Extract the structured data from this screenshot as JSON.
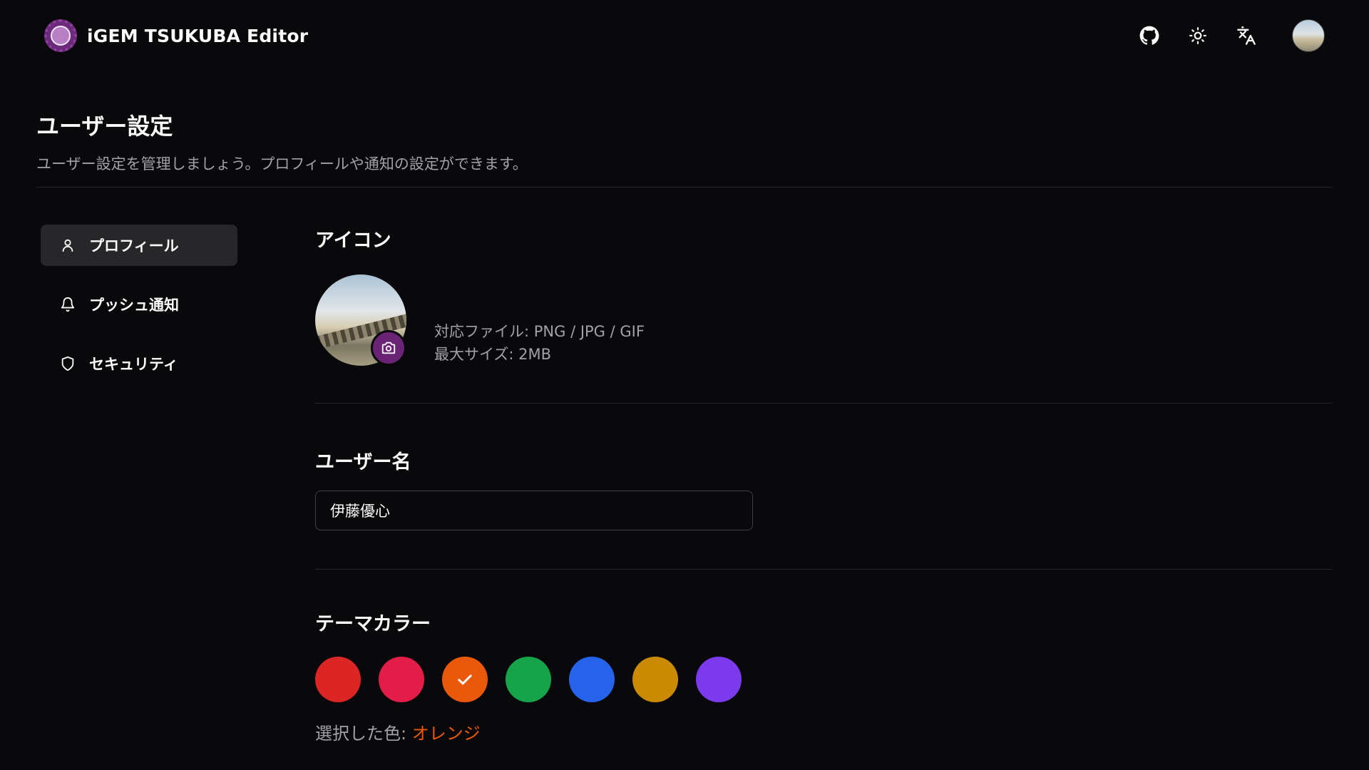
{
  "header": {
    "brand_title": "iGEM TSUKUBA Editor",
    "icons": [
      "github-icon",
      "sun-icon",
      "translate-icon"
    ]
  },
  "page": {
    "title": "ユーザー設定",
    "description": "ユーザー設定を管理しましょう。プロフィールや通知の設定ができます。"
  },
  "sidebar": {
    "items": [
      {
        "label": "プロフィール",
        "icon": "user-icon",
        "active": true
      },
      {
        "label": "プッシュ通知",
        "icon": "bell-icon",
        "active": false
      },
      {
        "label": "セキュリティ",
        "icon": "shield-icon",
        "active": false
      }
    ]
  },
  "profile": {
    "icon_section": {
      "title": "アイコン",
      "file_types": "対応ファイル: PNG / JPG / GIF",
      "max_size": "最大サイズ: 2MB"
    },
    "username_section": {
      "title": "ユーザー名",
      "value": "伊藤優心"
    },
    "theme_section": {
      "title": "テーマカラー",
      "colors": [
        {
          "name": "red",
          "hex": "#dc2626",
          "selected": false
        },
        {
          "name": "rose",
          "hex": "#e11d48",
          "selected": false
        },
        {
          "name": "orange",
          "hex": "#ea580c",
          "selected": true
        },
        {
          "name": "green",
          "hex": "#16a34a",
          "selected": false
        },
        {
          "name": "blue",
          "hex": "#2563eb",
          "selected": false
        },
        {
          "name": "amber",
          "hex": "#ca8a04",
          "selected": false
        },
        {
          "name": "violet",
          "hex": "#7c3aed",
          "selected": false
        }
      ],
      "selected_label": "選択した色: ",
      "selected_value": "オレンジ"
    }
  },
  "colors": {
    "background": "#09090b",
    "accent": "#6b2376",
    "muted_text": "#a1a1aa",
    "border": "#27272a"
  }
}
